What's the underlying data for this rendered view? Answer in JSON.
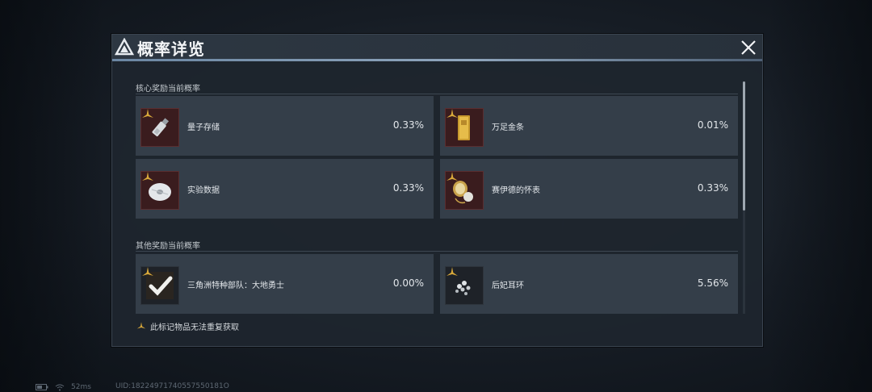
{
  "dialog": {
    "title": "概率详览",
    "close_icon": "close-x-icon"
  },
  "sections": [
    {
      "label": "核心奖励当前概率",
      "items": [
        {
          "name": "量子存储",
          "pct": "0.33%",
          "icon": "usb-drive-icon"
        },
        {
          "name": "万足金条",
          "pct": "0.01%",
          "icon": "gold-bar-icon"
        },
        {
          "name": "实验数据",
          "pct": "0.33%",
          "icon": "data-disc-icon"
        },
        {
          "name": "赛伊德的怀表",
          "pct": "0.33%",
          "icon": "pocket-watch-icon"
        }
      ]
    },
    {
      "label": "其他奖励当前概率",
      "items": [
        {
          "name": "三角洲特种部队：大地勇士",
          "pct": "0.00%",
          "icon": "checkmark-icon"
        },
        {
          "name": "后妃耳环",
          "pct": "5.56%",
          "icon": "earring-icon"
        }
      ]
    }
  ],
  "footer_note": "此标记物品无法重复获取",
  "status": {
    "ping": "52ms",
    "uid": "UID:18224971740557550181O"
  },
  "colors": {
    "accent_line": "#8fa6bd",
    "badge_gold": "#d9a93a",
    "card_bg": "#343e49",
    "thumb_red": "#3a1c1e"
  }
}
